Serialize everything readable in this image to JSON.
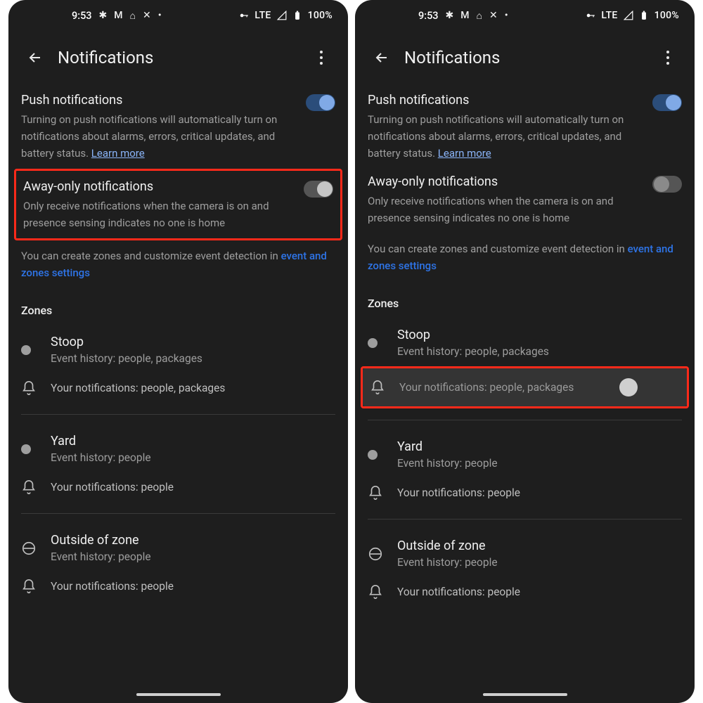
{
  "status": {
    "time": "9:53",
    "lte_label": "LTE",
    "battery_pct": "100%"
  },
  "appbar": {
    "title": "Notifications"
  },
  "push": {
    "title": "Push notifications",
    "desc": "Turning on push notifications will automatically turn on notifications about alarms, errors, critical updates, and battery status. ",
    "learn_more": "Learn more"
  },
  "away": {
    "title": "Away-only notifications",
    "desc": "Only receive notifications when the camera is on and presence sensing indicates no one is home"
  },
  "hint": {
    "pre": "You can create zones and customize event detection in ",
    "link": "event and zones settings"
  },
  "zones_label": "Zones",
  "zones": [
    {
      "name": "Stoop",
      "history": "Event history: people, packages",
      "notif": "Your notifications: people, packages"
    },
    {
      "name": "Yard",
      "history": "Event history: people",
      "notif": "Your notifications: people"
    },
    {
      "name": "Outside of zone",
      "history": "Event history: people",
      "notif": "Your notifications: people"
    }
  ]
}
